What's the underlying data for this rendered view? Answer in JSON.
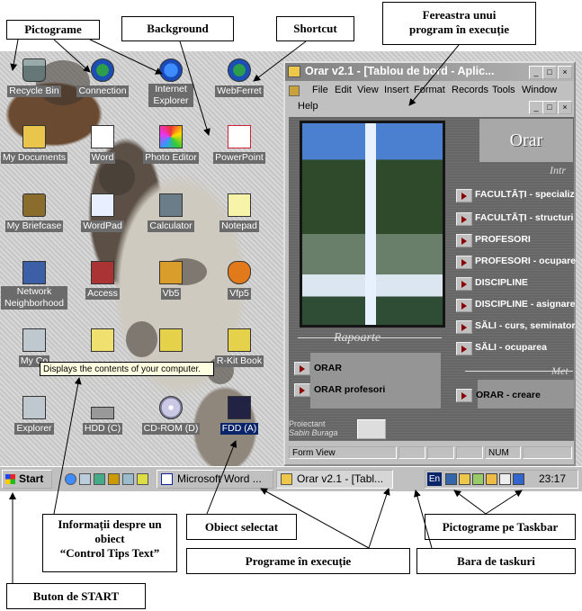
{
  "annotations": {
    "pictograme": "Pictograme",
    "background": "Background",
    "shortcut": "Shortcut",
    "fereastra_line1": "Fereastra unui",
    "fereastra_line2": "program în execuție",
    "info_line1": "Informații despre un",
    "info_line2": "obiect",
    "info_line3": "“Control Tips Text”",
    "obiect_selectat": "Obiect selectat",
    "programe": "Programe în execuție",
    "pictograme_taskbar": "Pictograme pe Taskbar",
    "bara": "Bara de taskuri",
    "buton_start": "Buton de START"
  },
  "desktop_icons": [
    {
      "label": "Recycle Bin",
      "icon": "recycle-bin-icon"
    },
    {
      "label": "Connection",
      "icon": "connection-icon"
    },
    {
      "label": "Internet Explorer",
      "icon": "internet-explorer-icon"
    },
    {
      "label": "WebFerret",
      "icon": "webferret-icon"
    },
    {
      "label": "My Documents",
      "icon": "folder-icon"
    },
    {
      "label": "Word",
      "icon": "word-icon"
    },
    {
      "label": "Photo Editor",
      "icon": "photo-editor-icon"
    },
    {
      "label": "PowerPoint",
      "icon": "powerpoint-icon"
    },
    {
      "label": "My Briefcase",
      "icon": "briefcase-icon"
    },
    {
      "label": "WordPad",
      "icon": "wordpad-icon"
    },
    {
      "label": "Calculator",
      "icon": "calculator-icon"
    },
    {
      "label": "Notepad",
      "icon": "notepad-icon"
    },
    {
      "label": "Network Neighborhood",
      "icon": "network-icon"
    },
    {
      "label": "Access",
      "icon": "access-icon"
    },
    {
      "label": "Vb5",
      "icon": "vb5-icon"
    },
    {
      "label": "Vfp5",
      "icon": "vfp5-icon"
    },
    {
      "label": "My Co",
      "icon": "my-computer-icon"
    },
    {
      "label": "",
      "icon": "chart-icon"
    },
    {
      "label": "",
      "icon": "kit-icon"
    },
    {
      "label": "R-Kit Book",
      "icon": "rkit-book-icon"
    },
    {
      "label": "Explorer",
      "icon": "explorer-icon"
    },
    {
      "label": "HDD (C)",
      "icon": "hdd-icon"
    },
    {
      "label": "CD-ROM (D)",
      "icon": "cdrom-icon"
    },
    {
      "label": "FDD (A)",
      "icon": "floppy-icon"
    }
  ],
  "tooltip": "Displays the contents of your computer.",
  "app_window": {
    "title": "Orar v2.1 - [Tablou de bord - Aplic...",
    "menu": [
      "File",
      "Edit",
      "View",
      "Insert",
      "Format",
      "Records",
      "Tools",
      "Window"
    ],
    "menu_help": "Help",
    "header": "Orar",
    "section_intro": "Intr",
    "section_rapoarte": "Rapoarte",
    "section_meta": "Met",
    "buttons": [
      "FACULTĂȚI - specializ",
      "FACULTĂȚI - structuri",
      "PROFESORI",
      "PROFESORI - ocupare",
      "DISCIPLINE",
      "DISCIPLINE - asignare",
      "SĂLI - curs, seminator,",
      "SĂLI - ocuparea"
    ],
    "reports": [
      "ORAR",
      "ORAR profesori"
    ],
    "meta_button": "ORAR - creare",
    "footer_line1": "Proiectant",
    "footer_line2": "Sabin Buraga",
    "status_view": "Form View",
    "status_num": "NUM"
  },
  "taskbar": {
    "start": "Start",
    "tasks": [
      "Microsoft Word ...",
      "Orar v2.1 - [Tabl..."
    ],
    "lang": "En",
    "clock": "23:17"
  }
}
